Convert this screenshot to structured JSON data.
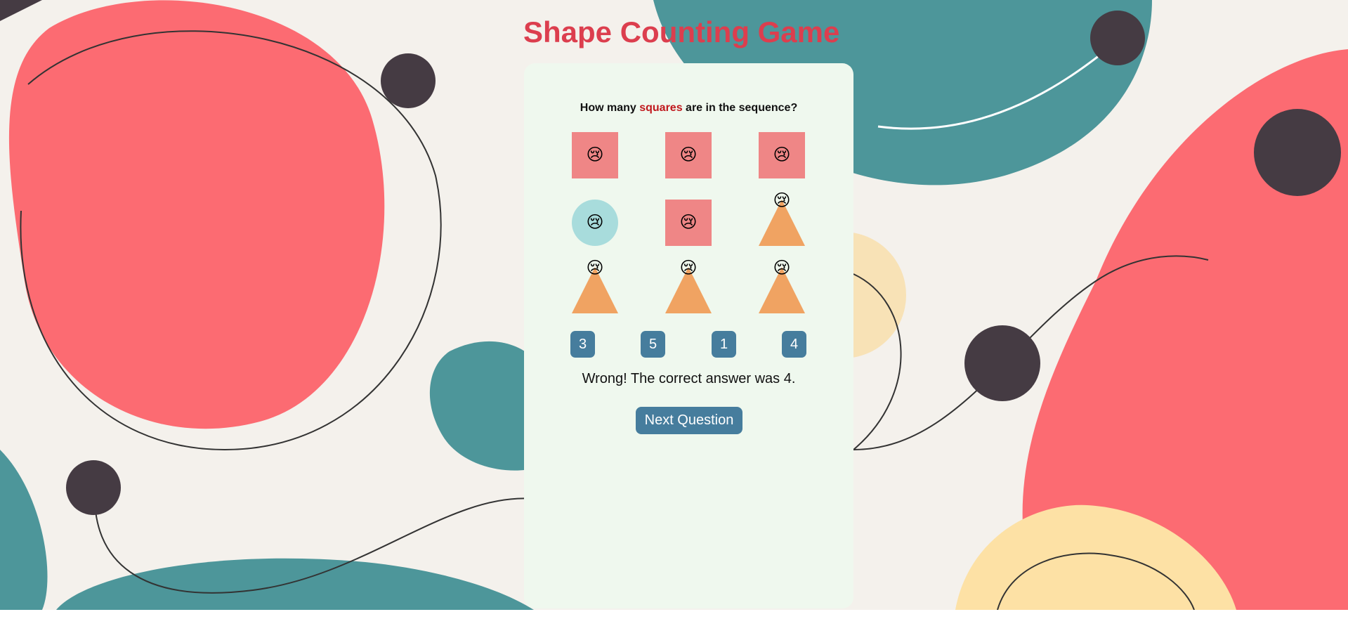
{
  "title": "Shape Counting Game",
  "question": {
    "prefix": "How many ",
    "target": "squares",
    "suffix": " are in the sequence?"
  },
  "grid": [
    {
      "shape": "square",
      "face": "😢"
    },
    {
      "shape": "square",
      "face": "😢"
    },
    {
      "shape": "square",
      "face": "😢"
    },
    {
      "shape": "circle",
      "face": "😢"
    },
    {
      "shape": "square",
      "face": "😢"
    },
    {
      "shape": "triangle",
      "face": "😢"
    },
    {
      "shape": "triangle",
      "face": "😢"
    },
    {
      "shape": "triangle",
      "face": "😢"
    },
    {
      "shape": "triangle",
      "face": "😢"
    }
  ],
  "answers": [
    "3",
    "5",
    "1",
    "4"
  ],
  "feedback": "Wrong! The correct answer was 4.",
  "next_button": "Next Question",
  "colors": {
    "title": "#dc3e4e",
    "panel": "#eff8ee",
    "square": "#ef8686",
    "circle": "#a8dcdc",
    "triangle": "#f0a362",
    "button": "#467d9d",
    "highlight": "#c0181d"
  }
}
